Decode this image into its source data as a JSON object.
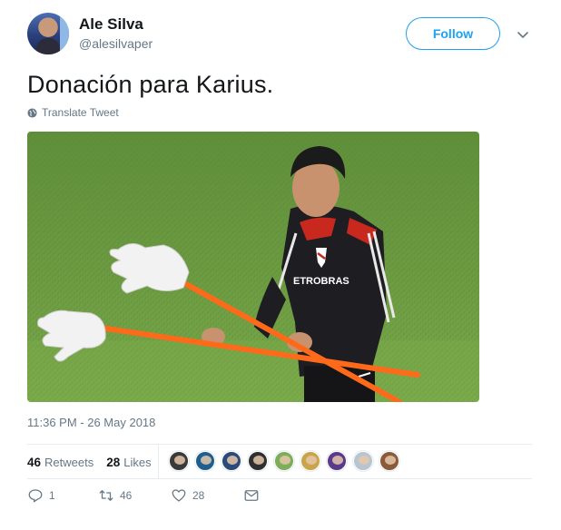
{
  "user": {
    "display_name": "Ale Silva",
    "handle": "@alesilvaper"
  },
  "follow_label": "Follow",
  "tweet": {
    "text": "Donación para Karius.",
    "translate_label": "Translate Tweet",
    "timestamp": "11:36 PM - 26 May 2018"
  },
  "stats": {
    "retweets_count": "46",
    "retweets_label": "Retweets",
    "likes_count": "28",
    "likes_label": "Likes"
  },
  "likers": [
    {
      "color": "#3a3a3a"
    },
    {
      "color": "#1f5f8f"
    },
    {
      "color": "#2a4a7a"
    },
    {
      "color": "#2f2f2f"
    },
    {
      "color": "#7fae5a"
    },
    {
      "color": "#c9a44a"
    },
    {
      "color": "#5a3a8a"
    },
    {
      "color": "#b8c4d0"
    },
    {
      "color": "#8a5a3a"
    }
  ],
  "actions": {
    "reply_count": "1",
    "retweet_count": "46",
    "like_count": "28"
  },
  "colors": {
    "accent": "#1da1f2",
    "secondary_text": "#657786",
    "primary_text": "#14171a"
  },
  "media": {
    "jersey_text": "ETROBRAS"
  }
}
